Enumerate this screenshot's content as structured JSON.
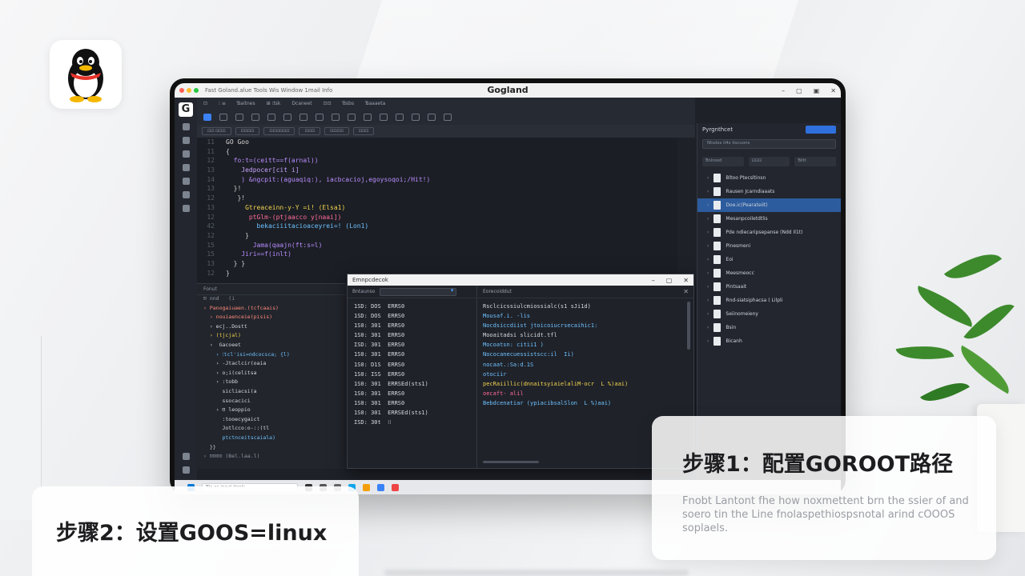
{
  "window": {
    "title": "Gogland",
    "menu_left": "Fast  Goland.alue  Tools  Wis Window 1mail Info"
  },
  "menubar": {
    "items": [
      "⊡",
      "⁝ ≡",
      "Ɓaitnes",
      "⊞ ⁝tsk",
      "Dcaneet",
      "⊡⊡",
      "Ɓsbs",
      "Ɓaaaeta"
    ]
  },
  "tabs": [
    "⊡⊡ ⊡⊡⊡",
    "⊡⊡⊡⊡",
    "⊡⊡⊡⊡⊡⊡",
    "⊡⊡⊡",
    "⊡⊡⊡⊡",
    "⊡⊡⊡"
  ],
  "editor": {
    "line_numbers": [
      "11",
      "11",
      "12",
      "13",
      "14",
      "13",
      "12",
      "13",
      "12",
      "42",
      "12",
      "15",
      "15",
      "13",
      "12"
    ],
    "lines": [
      {
        "text": "GO Goo",
        "color": "#d6d6d6"
      },
      {
        "text": "{",
        "color": "#cfcfcf"
      },
      {
        "text": "  fo:t=(ceitt==f(arnal))",
        "color": "#b88cff"
      },
      {
        "text": "    Jedpocer[cit i]",
        "color": "#c9a2ff"
      },
      {
        "text": "    ) &ngcpit:(aguaqiq:), iacbcacioj,egoysoqoi;/Hit!)",
        "color": "#b88cff"
      },
      {
        "text": "  }!",
        "color": "#cfcfcf"
      },
      {
        "text": "   }!",
        "color": "#cfcfcf"
      },
      {
        "text": "     Gtreaceinn-y-Y =i! (Elsa1)",
        "color": "#f2d34f"
      },
      {
        "text": "      ptGlm-(ptjaacco y[naai])",
        "color": "#ff6b9a"
      },
      {
        "text": "        bekaciiitacioaceyrei=! (Lon1)",
        "color": "#6ec1ff"
      },
      {
        "text": "     }",
        "color": "#cfcfcf"
      },
      {
        "text": "       Jama(qaajn(ft:s=l)",
        "color": "#b88cff"
      },
      {
        "text": "    Jiri==f(inlt)",
        "color": "#b88cff"
      },
      {
        "text": "  } }",
        "color": "#cfcfcf"
      },
      {
        "text": "}",
        "color": "#cfcfcf"
      }
    ]
  },
  "lower_pane": {
    "title": "Fonut",
    "tree": [
      {
        "text": "⊟ nnd   (i",
        "color": "#8c95a1"
      },
      {
        "text": "› Panogaiuaen.(tcfcaais)",
        "color": "#ff8a7a"
      },
      {
        "text": "  › nouiaenceie(pisis)",
        "color": "#ff8a7a"
      },
      {
        "text": "  › ecj..Dostt",
        "color": "#d6dae0"
      },
      {
        "text": "  › (tjcjal)",
        "color": "#f2d34f"
      },
      {
        "text": "  ›  Gacoeet",
        "color": "#d6dae0"
      },
      {
        "text": "    › ⁝tcl'isi=ndcocsca; {l)",
        "color": "#6ec1ff"
      },
      {
        "text": "    › -Jtaclcir(oaia",
        "color": "#d6dae0"
      },
      {
        "text": "    › o;i(celitsa",
        "color": "#d6dae0"
      },
      {
        "text": "    › :tobb",
        "color": "#d6dae0"
      },
      {
        "text": "      sicliacsi(a",
        "color": "#d6dae0"
      },
      {
        "text": "      ssocacici",
        "color": "#d6dae0"
      },
      {
        "text": "    › ⊡ leoppio",
        "color": "#d6dae0"
      },
      {
        "text": "      :tooecygaict",
        "color": "#d6dae0"
      },
      {
        "text": "      Jotlcco:o-::(tl",
        "color": "#d6dae0"
      },
      {
        "text": "      ptctnceitscaiala)",
        "color": "#6ec1ff"
      },
      {
        "text": "  }}",
        "color": "#cfcfcf"
      },
      {
        "text": "› ⊡⊡⊡⊡ (Bel.laa.l)",
        "color": "#8c95a1"
      }
    ]
  },
  "dialog": {
    "title": "Emnpcdecok",
    "left_label": "Bntaunso",
    "right_label": "Eorecoiddut",
    "table": [
      "1SD: DOS  ERRS0",
      "1SD: DOS  ERRS0",
      "1S0: 301  ERRS0",
      "1S0: 301  ERRS0",
      "ISD: 301  ERRS0",
      "1S0: 301  ERRS0",
      "1S0: D1S  ERRS0",
      "1S0: ISS  ERRS0",
      "1S0: 301  ERRSEd(sts1)",
      "1S0: 301  ERRS0",
      "1S0: 301  ERRS0",
      "1S0: 301  ERRSEd(sts1)",
      "ISD: 30t  ⁝⁝"
    ],
    "log": [
      {
        "text": "Rsclcicssiulcmiossialc(s1 sJi1d)",
        "color": "#d6dae0"
      },
      {
        "text": "Mousaf.i. -lis",
        "color": "#6ec1ff"
      },
      {
        "text": "Nocdsiccdiist jtoicoiucrsecaihic1:",
        "color": "#6ec1ff"
      },
      {
        "text": "Mooaitadsi slicidt.tfl",
        "color": "#d6dae0"
      },
      {
        "text": "Mocoatsn: citii1 )",
        "color": "#6ec1ff"
      },
      {
        "text": "Nococanecuessistscc:il  Ii)",
        "color": "#6ec1ff"
      },
      {
        "text": "nocaat.:Sa:d.1S",
        "color": "#6ec1ff"
      },
      {
        "text": "otociir",
        "color": "#6ec1ff"
      },
      {
        "text": "pecRaiillic(dnnaitsyiaielaliM-ocr  L %)aai)",
        "color": "#f2d34f"
      },
      {
        "text": "oecaft- alil",
        "color": "#ff6b9a"
      },
      {
        "text": "Bebdcenatiar (ypiacibsalSlon  L %)aai)",
        "color": "#6ec1ff"
      }
    ]
  },
  "right_panel": {
    "title": "Pyrgnthcet",
    "search_placeholder": "Ntsdss  li4s  ilscuons",
    "tab_labels": [
      "Ɓnlnsod",
      "⊡⊡⊡",
      "Ɓiltt"
    ],
    "items": [
      {
        "label": "Bltoo Ptecsltinsn",
        "selected": false
      },
      {
        "label": "Rausen Jcarndiaaats",
        "selected": false
      },
      {
        "label": "Doe.ic(Pearateiit)",
        "selected": true
      },
      {
        "label": "Mesanpcoiletdtlis",
        "selected": false
      },
      {
        "label": "Pde ndiecaripsepanse (Ndd Il1t)",
        "selected": false
      },
      {
        "label": "Pinesmeni",
        "selected": false
      },
      {
        "label": "Eoi",
        "selected": false
      },
      {
        "label": "Meesmeocc",
        "selected": false
      },
      {
        "label": "Pintsaait",
        "selected": false
      },
      {
        "label": "Rnd-siatsiphacsa ( Lilpli",
        "selected": false
      },
      {
        "label": "Seiinomeieny",
        "selected": false
      },
      {
        "label": "Bsin",
        "selected": false
      },
      {
        "label": "Bicanh",
        "selected": false
      }
    ]
  },
  "taskbar": {
    "search_placeholder": "Ɓls ac ipaut itools"
  },
  "caption_step1": {
    "title": "步骤1：配置GOROOT路径",
    "body": "Fnobt Lantont fhe how noxmettent brn the ssier of and soero tin the Line fnolaspethiospsnotal arind cOOOS soplaels."
  },
  "caption_step2": {
    "title": "步骤2：设置GOOS=linux"
  },
  "colors": {
    "accent": "#2f6fde",
    "ide_bg": "#1e2128",
    "selection": "#2d5c9e"
  }
}
